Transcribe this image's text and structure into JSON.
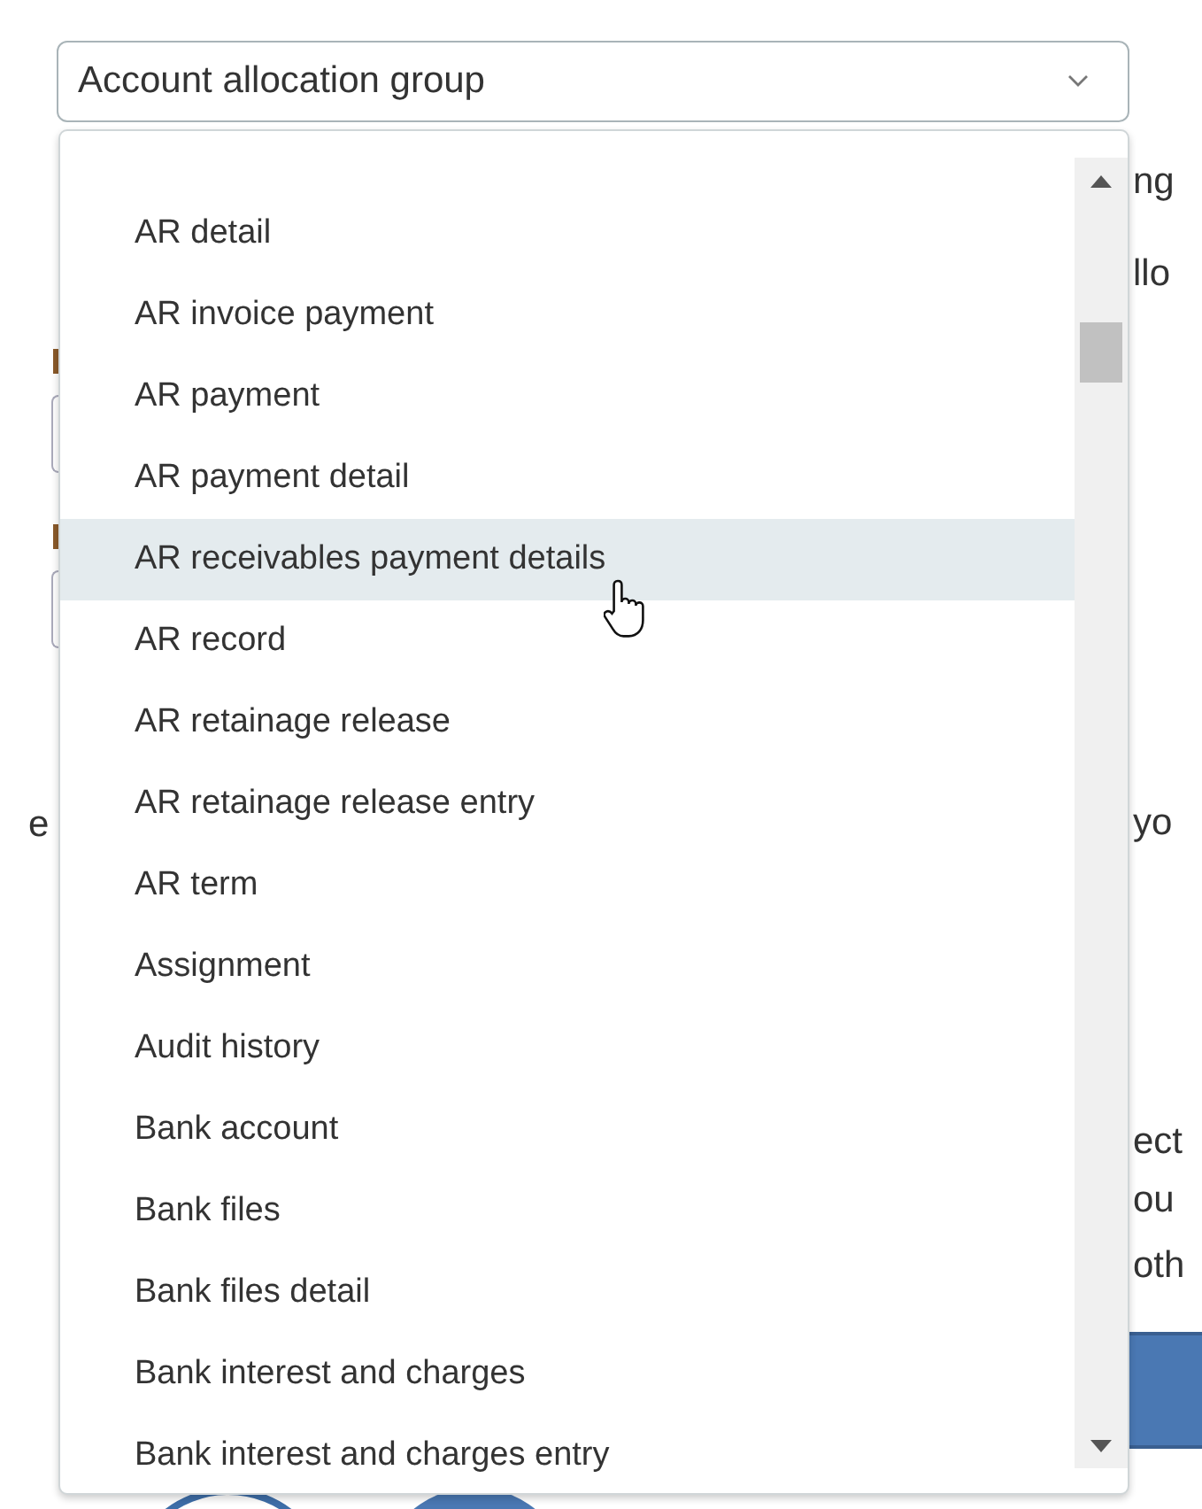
{
  "select": {
    "value": "Account allocation group"
  },
  "options": [
    {
      "label": "AR detail",
      "highlighted": false
    },
    {
      "label": "AR invoice payment",
      "highlighted": false
    },
    {
      "label": "AR payment",
      "highlighted": false
    },
    {
      "label": "AR payment detail",
      "highlighted": false
    },
    {
      "label": "AR receivables payment details",
      "highlighted": true
    },
    {
      "label": "AR record",
      "highlighted": false
    },
    {
      "label": "AR retainage release",
      "highlighted": false
    },
    {
      "label": "AR retainage release entry",
      "highlighted": false
    },
    {
      "label": "AR term",
      "highlighted": false
    },
    {
      "label": "Assignment",
      "highlighted": false
    },
    {
      "label": "Audit history",
      "highlighted": false
    },
    {
      "label": "Bank account",
      "highlighted": false
    },
    {
      "label": "Bank files",
      "highlighted": false
    },
    {
      "label": "Bank files detail",
      "highlighted": false
    },
    {
      "label": "Bank interest and charges",
      "highlighted": false
    },
    {
      "label": "Bank interest and charges entry",
      "highlighted": false
    }
  ],
  "background_text": {
    "left": [
      "e"
    ],
    "right": [
      "ng",
      "llo",
      "yo",
      "ect",
      "ou",
      "oth"
    ]
  }
}
